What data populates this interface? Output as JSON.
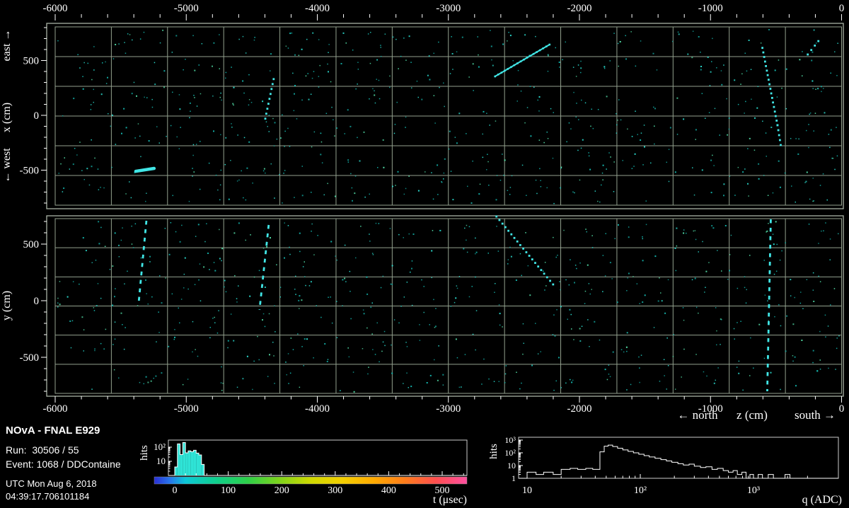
{
  "info": {
    "experiment": "NOvA - FNAL E929",
    "run_line": "Run:  30506 / 55",
    "event_line": "Event: 1068 / DDContaine",
    "utc_date": "UTC Mon Aug 6, 2018",
    "utc_time": "04:39:17.706101184"
  },
  "colors": {
    "frame": "#a9b3a5",
    "grid": "#93a18e",
    "hit": "#2ad9cc",
    "hit_dim": "#14b3ab",
    "hit_green": "#53dfa8",
    "track": "#41e6e6",
    "hist_fill": "#2fe3d6",
    "hist_line": "#ffffff",
    "axis": "#ffffff"
  },
  "chart_data": [
    {
      "type": "scatter",
      "name": "x-vs-z-view",
      "xlabel": "z (cm)",
      "ylabel": "x (cm)",
      "ylabel_top": "east →",
      "ylabel_mid": "x (cm)",
      "ylabel_bottom": "← west",
      "xlim": [
        -6000,
        0
      ],
      "ylim": [
        -850,
        850
      ],
      "xticks": [
        {
          "v": -6000,
          "label": "-6000"
        },
        {
          "v": -5000,
          "label": "-5000"
        },
        {
          "v": -4000,
          "label": "-4000"
        },
        {
          "v": -3000,
          "label": "-3000"
        },
        {
          "v": -2000,
          "label": "-2000"
        },
        {
          "v": -1000,
          "label": "-1000"
        },
        {
          "v": 0,
          "label": "0"
        }
      ],
      "yticks": [
        {
          "v": 500,
          "label": "500"
        },
        {
          "v": 0,
          "label": "0"
        },
        {
          "v": -500,
          "label": "-500"
        }
      ],
      "tracks": [
        {
          "from": [
            -5385,
            -510
          ],
          "to": [
            -5245,
            -484
          ],
          "style": "solid"
        },
        {
          "from": [
            -4397,
            -30
          ],
          "to": [
            -4333,
            330
          ],
          "style": "dots"
        },
        {
          "from": [
            -2644,
            355
          ],
          "to": [
            -2228,
            645
          ],
          "style": "dense"
        },
        {
          "from": [
            -604,
            615
          ],
          "to": [
            -489,
            -90
          ],
          "style": "dots"
        },
        {
          "from": [
            -489,
            -90
          ],
          "to": [
            -464,
            -271
          ],
          "style": "dots"
        },
        {
          "from": [
            -258,
            555
          ],
          "to": [
            -177,
            677
          ],
          "style": "dots"
        }
      ],
      "noise": {
        "count": 650,
        "seed": 42
      }
    },
    {
      "type": "scatter",
      "name": "y-vs-z-view",
      "xlabel": "z (cm)",
      "ylabel": "y (cm)",
      "xlabel_left": "← north",
      "xlabel_mid": "z (cm)",
      "xlabel_right": "south →",
      "xlim": [
        -6000,
        0
      ],
      "ylim": [
        -820,
        730
      ],
      "xticks": [
        {
          "v": -6000,
          "label": "-6000"
        },
        {
          "v": -5000,
          "label": "-5000"
        },
        {
          "v": -4000,
          "label": "-4000"
        },
        {
          "v": -3000,
          "label": "-3000"
        },
        {
          "v": -2000,
          "label": "-2000"
        },
        {
          "v": -1000,
          "label": "-1000"
        },
        {
          "v": 0,
          "label": "0"
        }
      ],
      "yticks": [
        {
          "v": 500,
          "label": "500"
        },
        {
          "v": 0,
          "label": "0"
        },
        {
          "v": -500,
          "label": "-500"
        }
      ],
      "tracks": [
        {
          "from": [
            -5304,
            706
          ],
          "to": [
            -5363,
            -19
          ],
          "style": "dash"
        },
        {
          "from": [
            -4371,
            669
          ],
          "to": [
            -4441,
            -81
          ],
          "style": "dash"
        },
        {
          "from": [
            -2633,
            744
          ],
          "to": [
            -2201,
            144
          ],
          "style": "dots"
        },
        {
          "from": [
            -540,
            719
          ],
          "to": [
            -567,
            -800
          ],
          "style": "dash"
        }
      ],
      "noise": {
        "count": 620,
        "seed": 77
      }
    },
    {
      "type": "histogram",
      "name": "hit-times",
      "xlabel": "t (μsec)",
      "ylabel": "hits",
      "ylog": true,
      "xlim": [
        -12,
        546
      ],
      "ylim": [
        1,
        316
      ],
      "bins": {
        "start": 0,
        "width": 5,
        "values": [
          4,
          170,
          30,
          210,
          40,
          55,
          48,
          60,
          38,
          28,
          6
        ]
      },
      "xticks": [
        {
          "v": 0,
          "label": "0",
          "color": "#00dcc8"
        },
        {
          "v": 100,
          "label": "100",
          "color": "#2fd04f"
        },
        {
          "v": 200,
          "label": "200",
          "color": "#7fd416"
        },
        {
          "v": 300,
          "label": "300",
          "color": "#e3cf00"
        },
        {
          "v": 400,
          "label": "400",
          "color": "#ff8d1e"
        },
        {
          "v": 500,
          "label": "500",
          "color": "#ff5a86"
        }
      ],
      "yticks": [
        {
          "v": 10,
          "label": "10"
        },
        {
          "v": 100,
          "label": "10²"
        }
      ],
      "colorbar_stops": [
        [
          0,
          "#2a2fd4"
        ],
        [
          5,
          "#2776ec"
        ],
        [
          10,
          "#0cc8d8"
        ],
        [
          20,
          "#0fd08c"
        ],
        [
          30,
          "#2ed048"
        ],
        [
          40,
          "#7ed41c"
        ],
        [
          50,
          "#cfd900"
        ],
        [
          60,
          "#f2cf00"
        ],
        [
          70,
          "#ffab00"
        ],
        [
          80,
          "#ff7d1a"
        ],
        [
          90,
          "#ff4f4f"
        ],
        [
          100,
          "#ff4fa0"
        ]
      ]
    },
    {
      "type": "histogram",
      "name": "hit-charge",
      "xlabel": "q (ADC)",
      "ylabel": "hits",
      "xlog": true,
      "ylog": true,
      "xlim": [
        10,
        3000
      ],
      "ylim": [
        1,
        1000
      ],
      "steps": [
        [
          10,
          3
        ],
        [
          12,
          2
        ],
        [
          14,
          3
        ],
        [
          17,
          2
        ],
        [
          20,
          5
        ],
        [
          24,
          6
        ],
        [
          28,
          5
        ],
        [
          33,
          6
        ],
        [
          38,
          5
        ],
        [
          44,
          120
        ],
        [
          48,
          330
        ],
        [
          52,
          400
        ],
        [
          57,
          310
        ],
        [
          63,
          230
        ],
        [
          70,
          170
        ],
        [
          78,
          130
        ],
        [
          87,
          100
        ],
        [
          97,
          78
        ],
        [
          108,
          60
        ],
        [
          120,
          47
        ],
        [
          135,
          37
        ],
        [
          152,
          29
        ],
        [
          170,
          23
        ],
        [
          190,
          18
        ],
        [
          215,
          14
        ],
        [
          240,
          11
        ],
        [
          270,
          13
        ],
        [
          300,
          9
        ],
        [
          340,
          7
        ],
        [
          380,
          8
        ],
        [
          430,
          5
        ],
        [
          480,
          6
        ],
        [
          540,
          4
        ],
        [
          600,
          3
        ],
        [
          660,
          4
        ],
        [
          720,
          2
        ],
        [
          790,
          3
        ],
        [
          860,
          1
        ],
        [
          930,
          2
        ],
        [
          1000,
          1
        ],
        [
          1100,
          2
        ],
        [
          1200,
          1
        ],
        [
          1350,
          2
        ],
        [
          1500,
          1
        ],
        [
          1700,
          1
        ],
        [
          1900,
          2
        ],
        [
          2100,
          1
        ],
        [
          2400,
          0
        ]
      ],
      "xticks": [
        {
          "v": 10,
          "label": "10"
        },
        {
          "v": 100,
          "label": "10²"
        },
        {
          "v": 1000,
          "label": "10³"
        }
      ],
      "yticks": [
        {
          "v": 1,
          "label": "1"
        },
        {
          "v": 10,
          "label": "10"
        },
        {
          "v": 100,
          "label": "10²"
        },
        {
          "v": 1000,
          "label": "10³"
        }
      ]
    }
  ]
}
